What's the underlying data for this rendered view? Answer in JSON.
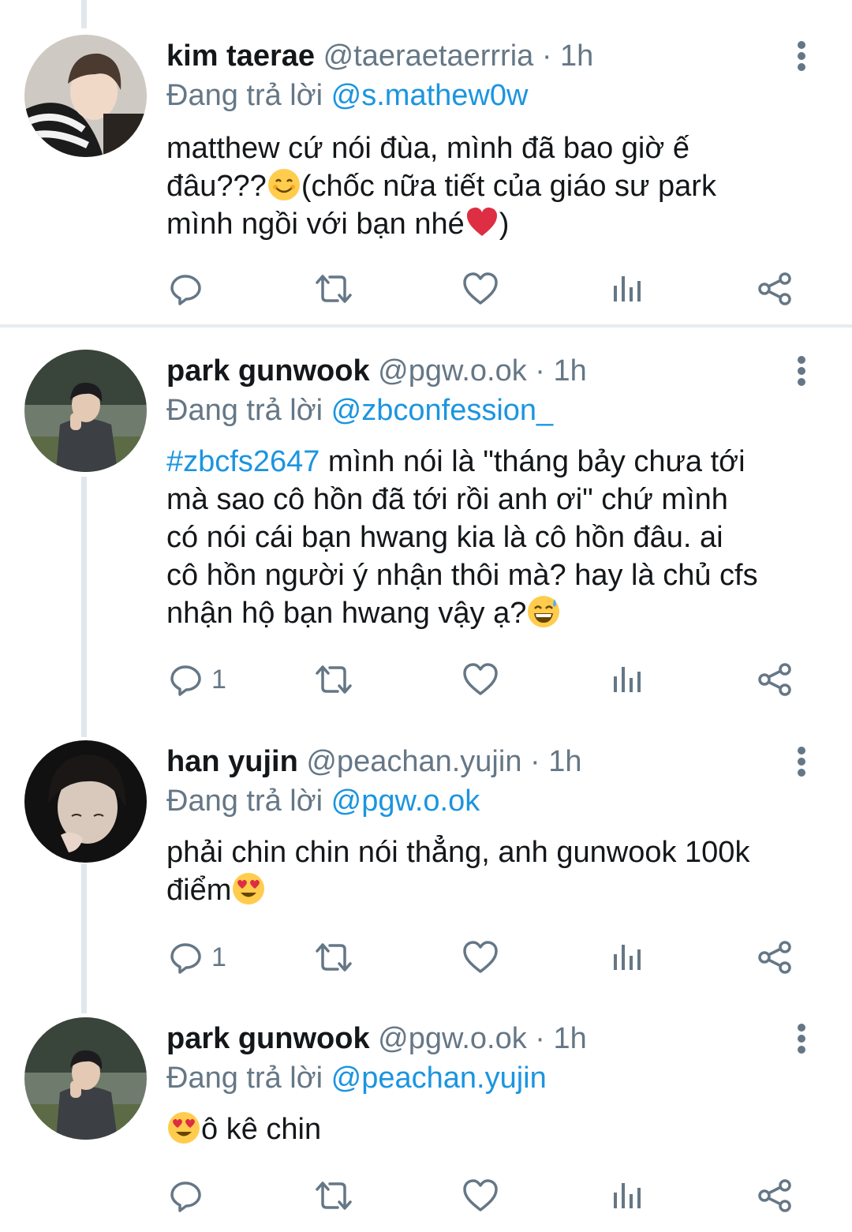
{
  "colors": {
    "link": "#1b95e0",
    "muted": "#657786",
    "text": "#14171a",
    "heart_emoji": "#dd2e44"
  },
  "tweets": [
    {
      "name": "kim taerae",
      "handle": "@taeraetaerrria",
      "sep": "·",
      "time": "1h",
      "reply_prefix": "Đang trả lời",
      "reply_to": "@s.mathew0w",
      "text_lines": [
        "matthew cứ nói đùa, mình đã bao giờ ế",
        "đâu???",
        "(chốc nữa tiết của giáo sư park",
        "mình ngồi với bạn nhé",
        ")"
      ],
      "reply_count": ""
    },
    {
      "name": "park gunwook",
      "handle": "@pgw.o.ok",
      "sep": "·",
      "time": "1h",
      "reply_prefix": "Đang trả lời",
      "reply_to": "@zbconfession_",
      "hashtag": "#zbcfs2647",
      "text_lines": [
        " mình nói là \"tháng bảy chưa tới",
        "mà sao cô hồn đã tới rồi anh ơi\" chứ mình",
        "có nói cái bạn hwang kia là cô hồn đâu. ai",
        "cô hồn người ý nhận thôi mà? hay là chủ cfs",
        "nhận hộ bạn hwang vậy ạ?"
      ],
      "reply_count": "1"
    },
    {
      "name": "han yujin",
      "handle": "@peachan.yujin",
      "sep": "·",
      "time": "1h",
      "reply_prefix": "Đang trả lời",
      "reply_to": "@pgw.o.ok",
      "text_lines": [
        "phải chin chin nói thẳng, anh gunwook 100k",
        "điểm"
      ],
      "reply_count": "1"
    },
    {
      "name": "park gunwook",
      "handle": "@pgw.o.ok",
      "sep": "·",
      "time": "1h",
      "reply_prefix": "Đang trả lời",
      "reply_to": "@peachan.yujin",
      "text_lines": [
        "ô kê chin"
      ],
      "reply_count": ""
    }
  ],
  "icons": [
    "reply-icon",
    "retweet-icon",
    "like-icon",
    "analytics-icon",
    "share-icon",
    "more-icon"
  ]
}
